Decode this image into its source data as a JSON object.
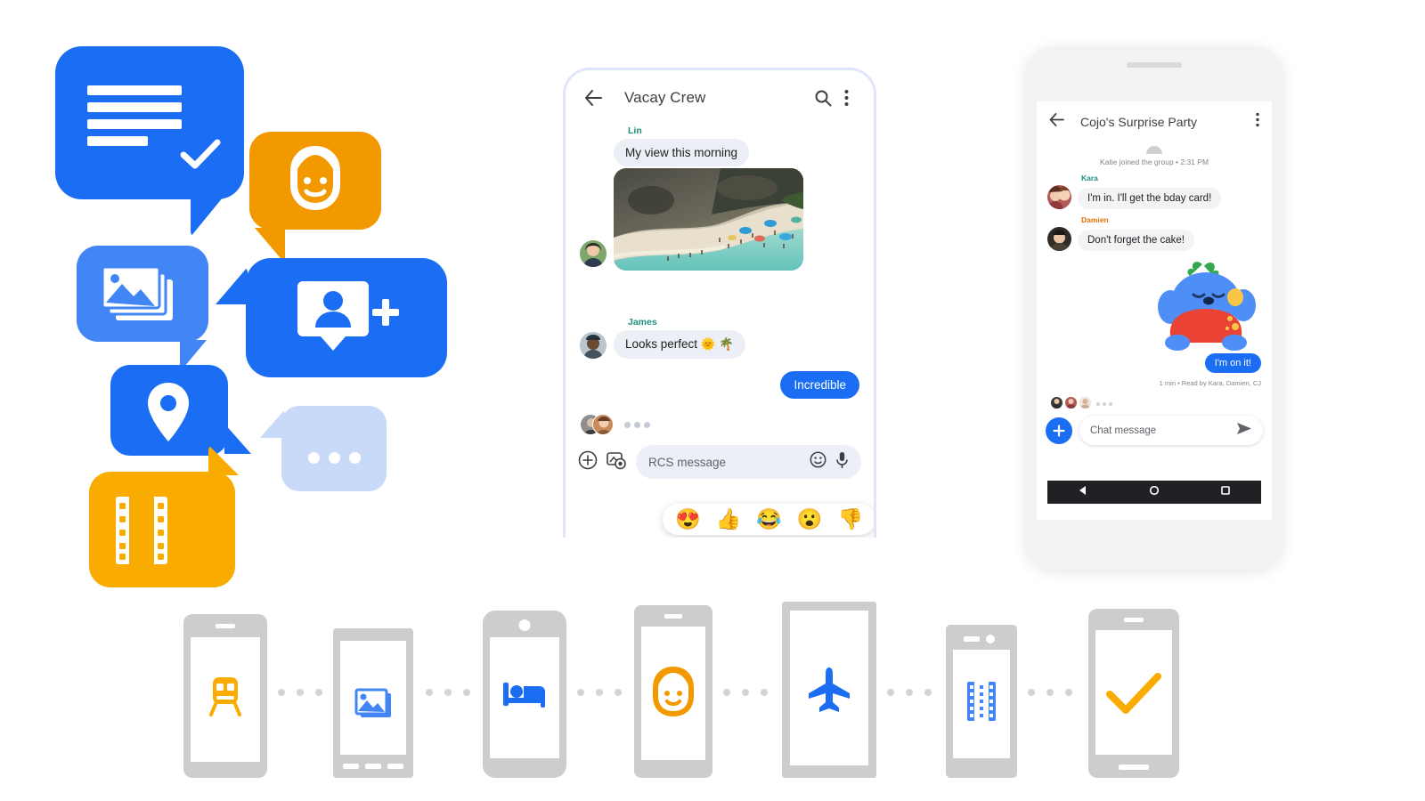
{
  "colors": {
    "blue_primary": "#1b6ef3",
    "blue_light": "#4285f4",
    "blue_pale": "#c8daf8",
    "orange": "#f29900",
    "yellow": "#f9ab00",
    "teal_name": "#1e8e7e",
    "amber_name": "#e8710a",
    "bubble_in": "#eceff5",
    "phone_gray": "#cdcdcd"
  },
  "icon_cluster": {
    "bubbles": [
      {
        "id": "message-check",
        "icon": "message-lines-check-icon",
        "color": "#1b6ef3"
      },
      {
        "id": "person",
        "icon": "person-face-icon",
        "color": "#f29900"
      },
      {
        "id": "photos",
        "icon": "photos-stack-icon",
        "color": "#4285f4"
      },
      {
        "id": "add-contact",
        "icon": "add-contact-icon",
        "color": "#1b6ef3"
      },
      {
        "id": "location",
        "icon": "location-pin-icon",
        "color": "#1b6ef3"
      },
      {
        "id": "typing",
        "icon": "typing-dots-icon",
        "color": "#c8daf8"
      },
      {
        "id": "video",
        "icon": "film-strip-icon",
        "color": "#f9ab00"
      }
    ]
  },
  "phone_middle": {
    "appbar": {
      "back_icon": "back-arrow-icon",
      "title": "Vacay Crew",
      "search_icon": "search-icon",
      "overflow_icon": "more-vert-icon"
    },
    "messages": [
      {
        "sender": "Lin",
        "text": "My view this morning",
        "type": "in",
        "sender_color": "teal"
      },
      {
        "sender": "",
        "text": "",
        "type": "photo",
        "photo_alt": "beach cove photo"
      },
      {
        "sender": "James",
        "text": "Looks perfect 🌞 🌴",
        "type": "in",
        "sender_color": "teal"
      },
      {
        "sender": "",
        "text": "Incredible",
        "type": "out"
      }
    ],
    "reactions": [
      "😍",
      "👍",
      "😂",
      "😮",
      "👎"
    ],
    "typing_indicator": {
      "dots": 3,
      "avatar_count": 2
    },
    "composer": {
      "plus_icon": "plus-circle-icon",
      "gallery_icon": "gallery-camera-icon",
      "placeholder": "RCS message",
      "emoji_icon": "emoji-smiley-icon",
      "mic_icon": "microphone-icon"
    }
  },
  "phone_right": {
    "appbar": {
      "back_icon": "back-arrow-icon",
      "title": "Cojo's Surprise Party",
      "overflow_icon": "more-vert-icon"
    },
    "system_note": "Katie joined the group • 2:31 PM",
    "messages": [
      {
        "sender": "Kara",
        "text": "I'm in. I'll get the bday card!",
        "type": "in",
        "sender_color": "teal"
      },
      {
        "sender": "Damien",
        "text": "Don't forget the cake!",
        "type": "in",
        "sender_color": "amber"
      },
      {
        "sender": "",
        "text": "",
        "type": "sticker",
        "sticker_alt": "blue creature hugging red heart sticker"
      },
      {
        "sender": "",
        "text": "I'm on it!",
        "type": "out"
      }
    ],
    "receipt": "1 min • Read by Kara, Damien, CJ",
    "read_avatars": 3,
    "composer": {
      "plus_icon": "plus-fab-icon",
      "placeholder": "Chat message",
      "send_icon": "send-icon"
    },
    "navbar": {
      "back_icon": "nav-back-triangle-icon",
      "home_icon": "nav-home-circle-icon",
      "recents_icon": "nav-recents-square-icon"
    }
  },
  "bottom_strip": {
    "phones": [
      {
        "icon": "train-icon",
        "color": "#f9ab00",
        "style": "notch-top"
      },
      {
        "icon": "photos-icon",
        "color": "#4285f4",
        "style": "buttons-bottom"
      },
      {
        "icon": "bed-icon",
        "color": "#1b6ef3",
        "style": "camdot-top"
      },
      {
        "icon": "person-icon",
        "color": "#f29900",
        "style": "notch-top"
      },
      {
        "icon": "airplane-icon",
        "color": "#1b6ef3",
        "style": "plain"
      },
      {
        "icon": "film-icon",
        "color": "#4285f4",
        "style": "notch-cam-top"
      },
      {
        "icon": "check-icon",
        "color": "#f9ab00",
        "style": "notch-bar-bottom"
      }
    ],
    "separator_dots_per_gap": 3
  }
}
